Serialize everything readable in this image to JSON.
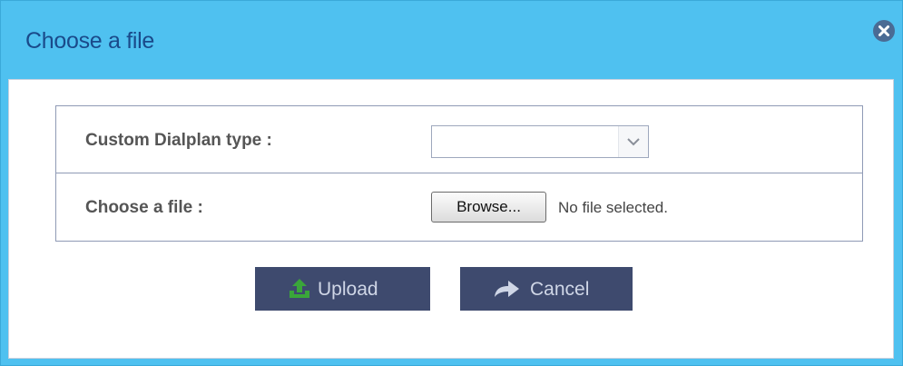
{
  "dialog": {
    "title": "Choose a file",
    "close_icon": "close-circle-icon"
  },
  "form": {
    "dialplan_type": {
      "label": "Custom Dialplan type :",
      "selected_value": ""
    },
    "file": {
      "label": "Choose a file :",
      "browse_label": "Browse...",
      "status": "No file selected."
    }
  },
  "actions": {
    "upload": {
      "label": "Upload",
      "icon": "upload-icon",
      "icon_color": "#3aa63a"
    },
    "cancel": {
      "label": "Cancel",
      "icon": "forward-arrow-icon"
    }
  },
  "colors": {
    "titlebar": "#4fc1f0",
    "title_text": "#1a4a8a",
    "button_bg": "#3e4a6e"
  }
}
